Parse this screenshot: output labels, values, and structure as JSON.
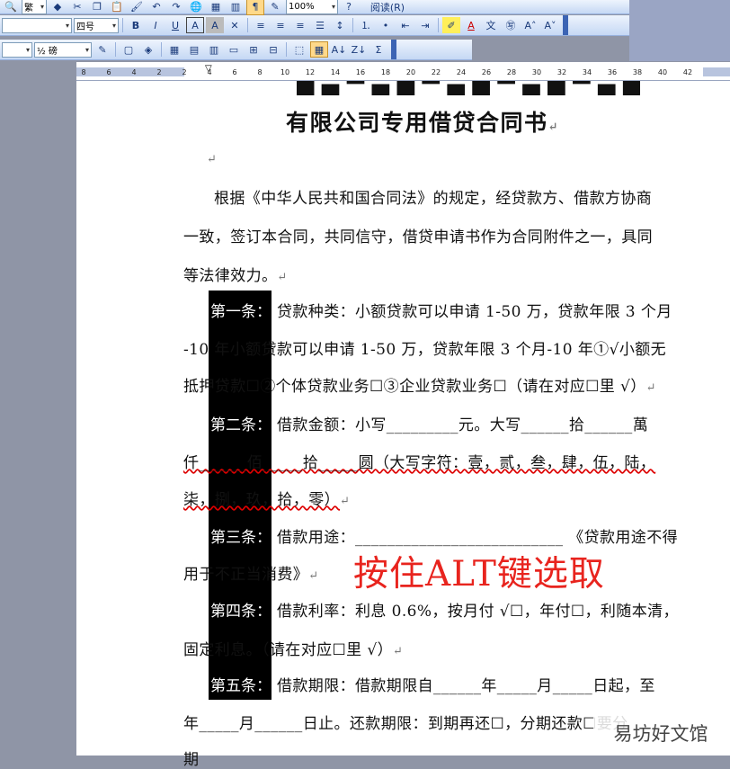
{
  "toolbar": {
    "row1": {
      "style_combo": "繁",
      "zoom": "100%",
      "read_label": "阅读(R)"
    },
    "row2": {
      "font_name": "",
      "font_size": "四号",
      "bold": "B",
      "italic": "I",
      "underline": "U",
      "char_border": "A",
      "char_shade": "A",
      "font_color": "A"
    },
    "row3": {
      "indent_combo": "",
      "line_weight": "½ 磅",
      "sort_asc": "A↓",
      "sigma": "Σ"
    }
  },
  "ruler": {
    "ticks": [
      "8",
      "6",
      "4",
      "2",
      "2",
      "4",
      "6",
      "8",
      "10",
      "12",
      "14",
      "16",
      "18",
      "20",
      "22",
      "24",
      "26",
      "28",
      "30",
      "32",
      "34",
      "36",
      "38",
      "40",
      "42"
    ]
  },
  "document": {
    "title_line2": "有限公司专用借贷合同书",
    "para_intro": [
      "根据《中华人民共和国合同法》的规定，经贷款方、借款方协商",
      "一致，签订本合同，共同信守，借贷申请书作为合同附件之一，具同",
      "等法律效力。"
    ],
    "article1": [
      "贷款种类：小额贷款可以申请 1-50 万，贷款年限 3 个月",
      "-10 年小额贷款可以申请 1-50 万，贷款年限 3 个月-10 年①√小额无",
      "抵押贷款☐②个体贷款业务☐③企业贷款业务☐（请在对应☐里 √）"
    ],
    "article2": [
      "借款金额：小写_________元。大写______拾______萬",
      "仟______佰_____拾_____圆（大写字符：壹，贰，叁，肆，伍，陆，",
      "柒，捌，玖，拾，零）"
    ],
    "article3": [
      "借款用途：__________________________ 《贷款用途不得",
      "用于不正当消费》"
    ],
    "article4": [
      "借款利率：利息 0.6%，按月付 √☐，年付☐，利随本清，",
      "固定利息。（请在对应☐里 √）"
    ],
    "article5": [
      "借款期限：借款期限自______年_____月_____日起，至",
      "年_____月______日止。还款期限：到期再还☐，分期还款☐要分",
      "期"
    ],
    "selected_labels": [
      "第一条：",
      "第二条：",
      "第三条：",
      "第四条：",
      "第五条："
    ]
  },
  "annotation": "按住ALT键选取",
  "watermark": "易坊好文馆"
}
